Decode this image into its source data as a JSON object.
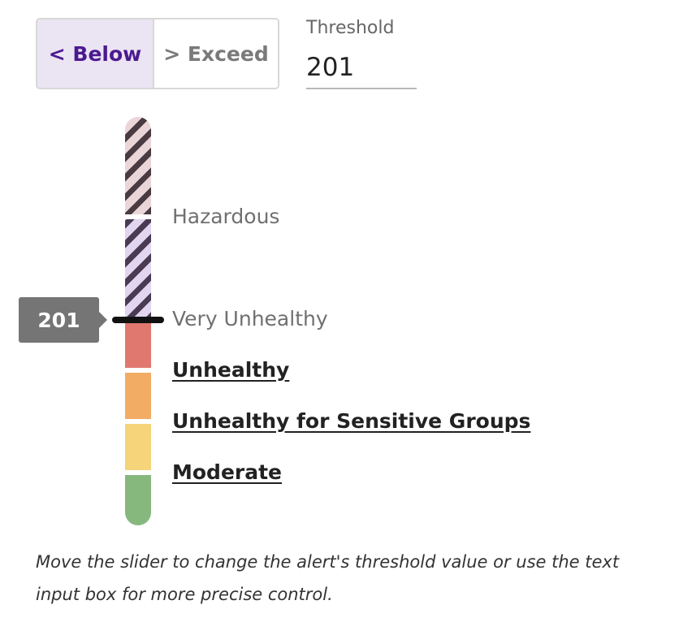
{
  "direction_toggle": {
    "options": [
      {
        "label": "< Below",
        "selected": true
      },
      {
        "label": "> Exceed",
        "selected": false
      }
    ]
  },
  "threshold": {
    "label": "Threshold",
    "value": "201"
  },
  "slider": {
    "value": "201",
    "categories": [
      {
        "label": "Hazardous",
        "style": "muted",
        "pattern": "striped"
      },
      {
        "label": "Very Unhealthy",
        "style": "muted",
        "pattern": "striped"
      },
      {
        "label": "Unhealthy",
        "style": "link",
        "color": "#e07870"
      },
      {
        "label": "Unhealthy for Sensitive Groups",
        "style": "link",
        "color": "#f2ac64"
      },
      {
        "label": "Moderate",
        "style": "link",
        "color": "#f5d47a"
      }
    ],
    "good_color": "#86b87e"
  },
  "help_text": "Move the slider to change the alert's threshold value or use the text input box for more precise control."
}
